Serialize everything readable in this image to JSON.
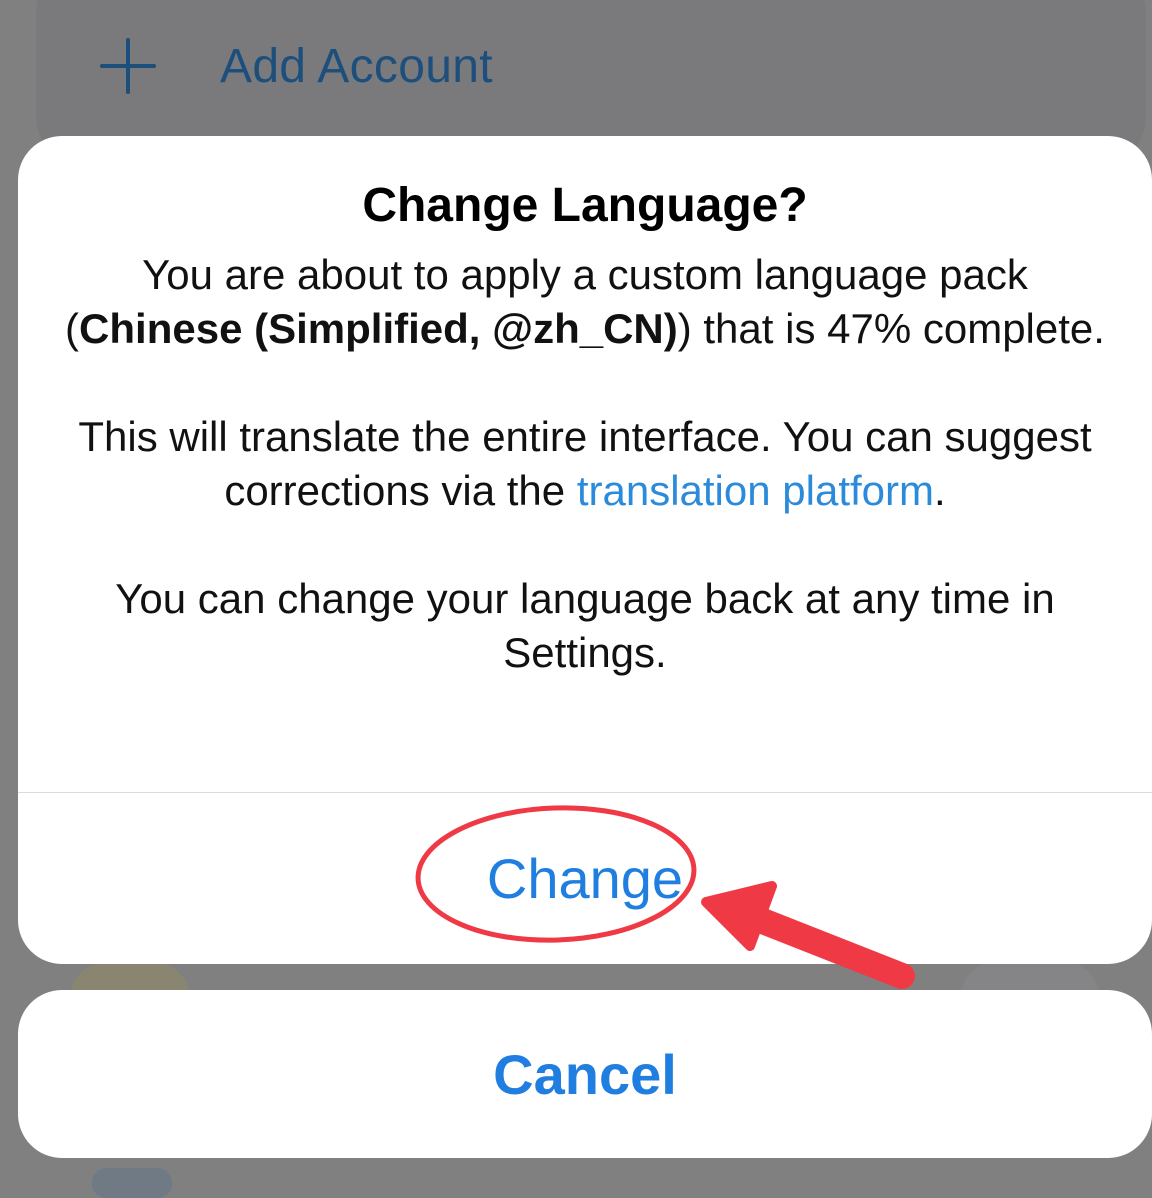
{
  "background": {
    "add_account_label": "Add Account",
    "plus_icon": "plus-icon"
  },
  "dialog": {
    "title": "Change Language?",
    "message_1_pre": "You are about to apply a custom language pack (",
    "message_1_bold": "Chinese (Simplified, @zh_CN)",
    "message_1_post": ") that is 47% complete.",
    "message_2_pre": "This will translate the entire interface. You can suggest corrections via the ",
    "message_2_link": "translation platform",
    "message_2_post": ".",
    "message_3": "You can change your language back at any time in Settings.",
    "change_label": "Change",
    "cancel_label": "Cancel"
  },
  "annotation": {
    "color": "#ef3a45",
    "highlight_shape": "ellipse",
    "pointer_icon": "arrow-icon"
  },
  "colors": {
    "accent": "#1f7ee0",
    "link": "#2b8ad9",
    "overlay": "#808081"
  }
}
